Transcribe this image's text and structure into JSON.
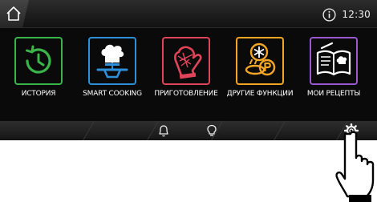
{
  "status_bar": {
    "time": "12:30"
  },
  "tiles": [
    {
      "label": "ИСТОРИЯ",
      "icon": "history-icon",
      "color": "#39b54a"
    },
    {
      "label": "SMART COOKING",
      "icon": "chef-hat-icon",
      "color": "#2f8fd8"
    },
    {
      "label": "ПРИГОТОВЛЕНИЕ",
      "icon": "oven-mitt-icon",
      "color": "#e04458"
    },
    {
      "label": "ДРУГИЕ ФУНКЦИИ",
      "icon": "other-functions-icon",
      "color": "#f5a623"
    },
    {
      "label": "МОИ РЕЦЕПТЫ",
      "icon": "recipe-book-icon",
      "color": "#9b59d0"
    }
  ],
  "bottom_bar": {
    "icons": [
      "bell-icon",
      "lightbulb-icon",
      "gear-icon"
    ]
  },
  "overlay": {
    "icon": "pointing-hand-icon"
  }
}
